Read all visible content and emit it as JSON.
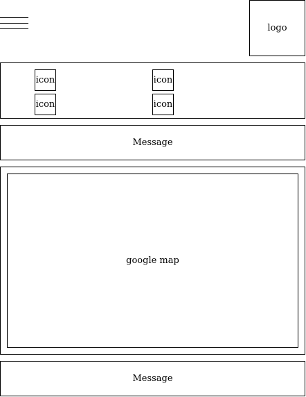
{
  "header": {
    "menu_icon": "hamburger-menu-icon",
    "logo_label": "logo"
  },
  "icons_panel": {
    "items": [
      {
        "label": "icon"
      },
      {
        "label": "icon"
      },
      {
        "label": "icon"
      },
      {
        "label": "icon"
      }
    ]
  },
  "message_top": {
    "label": "Message"
  },
  "map": {
    "label": "google map"
  },
  "message_bottom": {
    "label": "Message"
  }
}
